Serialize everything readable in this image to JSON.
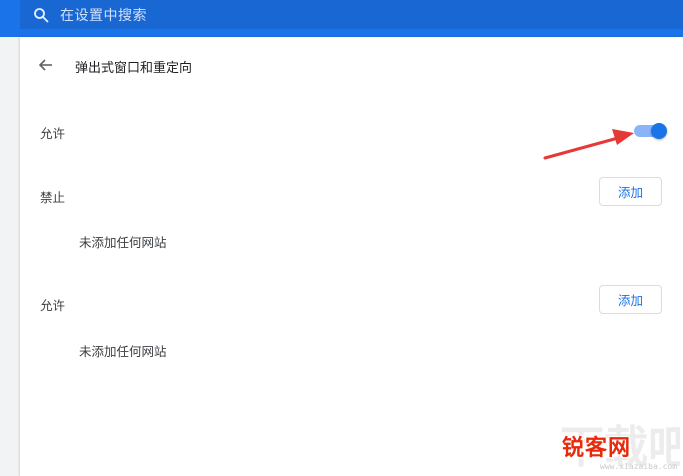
{
  "search": {
    "placeholder": "在设置中搜索",
    "icon": "search-icon"
  },
  "header": {
    "title": "弹出式窗口和重定向",
    "back_icon": "arrow-left-icon"
  },
  "allow_toggle": {
    "label": "允许",
    "state": "on",
    "color": "#1a73e8"
  },
  "blocked": {
    "label": "禁止",
    "add_button": "添加",
    "empty_text": "未添加任何网站"
  },
  "allowed": {
    "label": "允许",
    "add_button": "添加",
    "empty_text": "未添加任何网站"
  },
  "watermark": {
    "brand": "锐客网",
    "url": "www.xiazaiba.com"
  },
  "colors": {
    "accent": "#1a73e8",
    "annotation_arrow": "#e53935"
  }
}
